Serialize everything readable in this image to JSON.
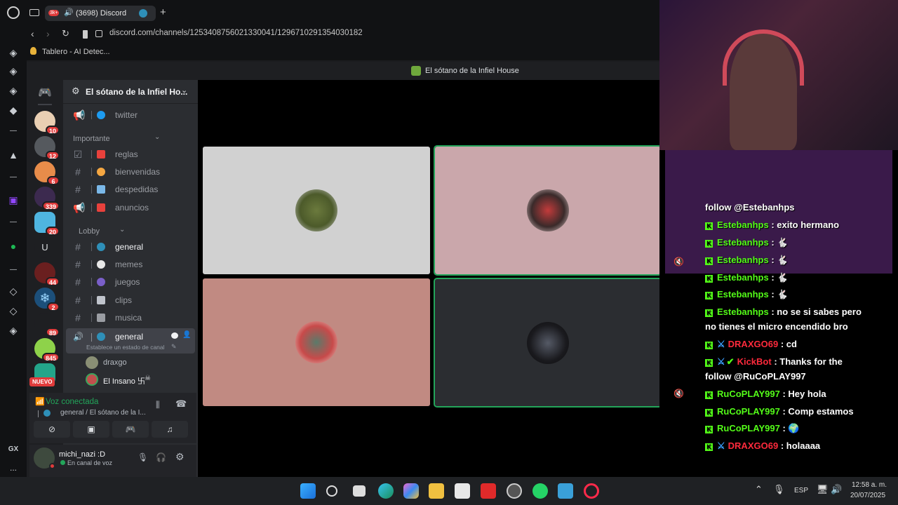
{
  "browser": {
    "tab_title": "(3698) Discord",
    "tab_badge": "3k+",
    "new_tab": "+",
    "url": "discord.com/channels/1253408756021330041/1296710291354030182",
    "bookmark": "Tablero - AI Detec...",
    "gx_label": "GX",
    "more": "..."
  },
  "discord": {
    "window_title": "El sótano de la Infiel House",
    "server_name": "El sótano de la Infiel Ho...",
    "servers": [
      {
        "badge": "10"
      },
      {
        "badge": "12"
      },
      {
        "badge": "6"
      },
      {
        "badge": "339"
      },
      {
        "badge": "20"
      },
      {
        "letter": "U"
      },
      {
        "badge": "44"
      },
      {
        "badge": "2"
      },
      {
        "badge": "89"
      },
      {
        "badge": "845"
      },
      {
        "badge": "NUEVO"
      }
    ],
    "channels_top": [
      {
        "name": "twitter",
        "icon": "megaphone-icon"
      }
    ],
    "category_importante": "Importante",
    "channels_importante": [
      {
        "name": "reglas",
        "icon": "checkbox-icon"
      },
      {
        "name": "bienvenidas",
        "icon": "hash"
      },
      {
        "name": "despedidas",
        "icon": "hash"
      },
      {
        "name": "anuncios",
        "icon": "megaphone-icon"
      }
    ],
    "category_lobby": "Lobby",
    "channels_lobby": [
      {
        "name": "general",
        "icon": "hash"
      },
      {
        "name": "memes",
        "icon": "hash"
      },
      {
        "name": "juegos",
        "icon": "hash"
      },
      {
        "name": "clips",
        "icon": "hash"
      },
      {
        "name": "musica",
        "icon": "hash"
      }
    ],
    "voice_channel": {
      "name": "general",
      "status": "Establece un estado de canal",
      "members": [
        "draxgo",
        "El Insano 卐"
      ]
    },
    "voice_connected": {
      "title": "Voz conectada",
      "subtitle": "general / El sótano de la I..."
    },
    "user": {
      "name": "michi_nazi :D",
      "status": "En canal de voz"
    },
    "tiles": [
      {
        "bg": "#d1d1d1",
        "speaking": false
      },
      {
        "bg": "#caa7ab",
        "speaking": true
      },
      {
        "bg": "#c18a82",
        "speaking": false
      },
      {
        "bg": "#2b2d31",
        "speaking": true
      }
    ]
  },
  "chat": {
    "lines": [
      {
        "user": "",
        "text": "follow @Estebanhps",
        "color": "white"
      },
      {
        "user": "Estebanhps",
        "text": ": exito hermano",
        "color": "green"
      },
      {
        "user": "Estebanhps",
        "text": ": ",
        "color": "green"
      },
      {
        "user": "Estebanhps",
        "text": ": ",
        "color": "green"
      },
      {
        "user": "Estebanhps",
        "text": ": ",
        "color": "green"
      },
      {
        "user": "Estebanhps",
        "text": ": ",
        "color": "green"
      },
      {
        "user": "Estebanhps",
        "text": ": no se si sabes pero",
        "color": "green",
        "cont": "no tienes el micro encendido bro"
      },
      {
        "user": "DRAXGO69",
        "text": ": cd",
        "color": "red"
      },
      {
        "user": "KickBot",
        "text": ": Thanks for the",
        "color": "red",
        "cont": "follow @RuCoPLAY997"
      },
      {
        "user": "RuCoPLAY997",
        "text": ": Hey hola",
        "color": "green"
      },
      {
        "user": "RuCoPLAY997",
        "text": ": Comp estamos",
        "color": "green"
      },
      {
        "user": "RuCoPLAY997",
        "text": ": ",
        "color": "green"
      },
      {
        "user": "DRAXGO69",
        "text": ": holaaaa",
        "color": "red"
      }
    ]
  },
  "taskbar": {
    "lang": "ESP",
    "time": "12:58 a. m.",
    "date": "20/07/2025"
  }
}
